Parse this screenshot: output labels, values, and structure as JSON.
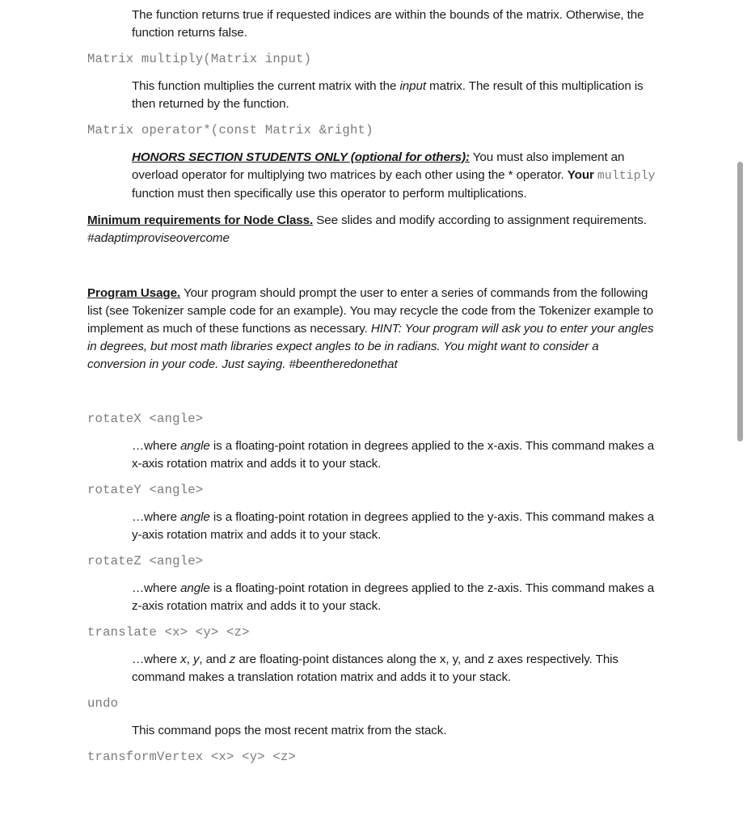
{
  "document": {
    "sections": [
      {
        "type": "paragraph",
        "id": "bounds_check_desc",
        "text": "The function returns true if requested indices are within the bounds of the matrix.  Otherwise, the function returns false."
      },
      {
        "type": "code",
        "id": "sig_multiply",
        "text": "Matrix multiply(Matrix input)"
      },
      {
        "type": "paragraph",
        "id": "multiply_desc_pre",
        "text": "This function multiplies the current matrix with the "
      },
      {
        "type": "paragraph",
        "id": "multiply_desc_em",
        "text": "input"
      },
      {
        "type": "paragraph",
        "id": "multiply_desc_post",
        "text": " matrix.  The result of this multiplication is then returned by the function."
      },
      {
        "type": "code",
        "id": "sig_operator_mult",
        "text": "Matrix operator*(const Matrix &right)"
      }
    ],
    "honors": {
      "heading": "HONORS SECTION STUDENTS ONLY (optional for others):",
      "body_part1": " You must also implement an overload operator for multiplying two matrices by each other using the * operator.  ",
      "body_bold": "Your",
      "body_code": "multiply",
      "body_part2": " function must then specifically use this operator to perform multiplications."
    },
    "node_class": {
      "heading": "Minimum requirements for Node Class.",
      "body": " See slides and modify according to assignment requirements.",
      "hashtag": "#adaptimproviseovercome"
    },
    "program_usage": {
      "heading": "Program Usage.",
      "body": "  Your program should prompt the user to enter a series of commands from the following list (see Tokenizer sample code for an example).  You may recycle the code from the Tokenizer example to implement as much of these functions as necessary.  ",
      "hint": "HINT: Your program will ask you to enter your angles in degrees, but most math libraries expect angles to be in radians.  You might want to consider a conversion in your code.  Just saying. #beentheredonethat"
    },
    "commands": [
      {
        "id": "rotateX",
        "signature": "rotateX <angle>",
        "desc_lead": "…where ",
        "desc_em": "angle",
        "desc_tail": " is a floating-point rotation in degrees applied to the x-axis.  This command makes a x-axis rotation matrix and adds it to your stack."
      },
      {
        "id": "rotateY",
        "signature": "rotateY <angle>",
        "desc_lead": "…where ",
        "desc_em": "angle",
        "desc_tail": " is a floating-point rotation in degrees applied to the y-axis.  This command makes a y-axis rotation matrix and adds it to your stack."
      },
      {
        "id": "rotateZ",
        "signature": "rotateZ <angle>",
        "desc_lead": "…where ",
        "desc_em": "angle",
        "desc_tail": " is a floating-point rotation in degrees applied to the z-axis.  This command makes a z-axis rotation matrix and adds it to your stack."
      },
      {
        "id": "translate",
        "signature": "translate <x> <y> <z>",
        "desc_lead": "…where ",
        "desc_em_x": "x",
        "desc_sep1": ", ",
        "desc_em_y": "y",
        "desc_sep2": ", and ",
        "desc_em_z": "z",
        "desc_tail": " are floating-point distances along the x, y, and z axes respectively.  This command makes a translation rotation matrix and adds it to your stack."
      },
      {
        "id": "undo",
        "signature": "undo",
        "desc_tail": "This command pops the most recent matrix from the stack."
      },
      {
        "id": "transformVertex",
        "signature": "transformVertex <x> <y> <z>",
        "desc_tail": ""
      }
    ],
    "scrollbar": {
      "position_label": "",
      "thumb_color": "#a8a8a8"
    },
    "colors": {
      "text": "#1a1a1a",
      "code": "#7b7b7b",
      "background": "#ffffff"
    }
  }
}
